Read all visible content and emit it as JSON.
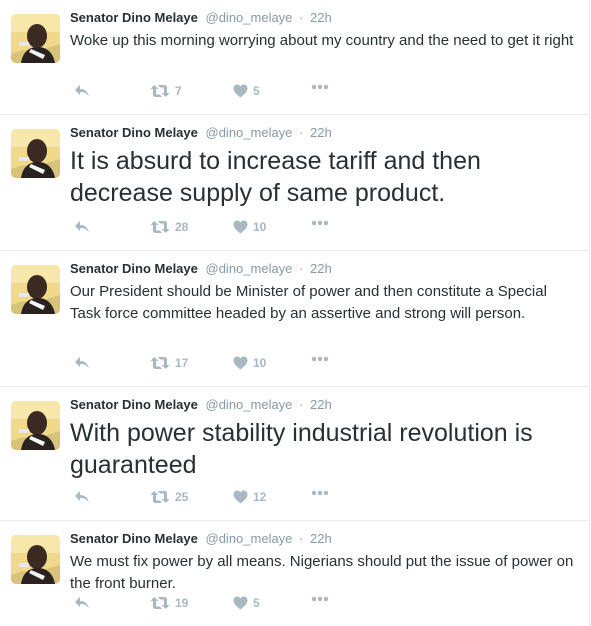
{
  "tweets": [
    {
      "name": "Senator Dino Melaye",
      "handle": "@dino_melaye",
      "separator": "·",
      "time": "22h",
      "text": "Woke up this morning worrying about my country and the need to get it right",
      "text_size": "small",
      "retweets": "7",
      "likes": "5"
    },
    {
      "name": "Senator Dino Melaye",
      "handle": "@dino_melaye",
      "separator": "·",
      "time": "22h",
      "text": "It is absurd to increase tariff and then decrease supply of same product.",
      "text_size": "large",
      "retweets": "28",
      "likes": "10"
    },
    {
      "name": "Senator Dino Melaye",
      "handle": "@dino_melaye",
      "separator": "·",
      "time": "22h",
      "text": "Our President should be Minister of power and then constitute a Special Task force committee headed by an assertive and strong will person.",
      "text_size": "small",
      "retweets": "17",
      "likes": "10"
    },
    {
      "name": "Senator Dino Melaye",
      "handle": "@dino_melaye",
      "separator": "·",
      "time": "22h",
      "text": "With power stability industrial revolution is guaranteed",
      "text_size": "large",
      "retweets": "25",
      "likes": "12"
    },
    {
      "name": "Senator Dino Melaye",
      "handle": "@dino_melaye",
      "separator": "·",
      "time": "22h",
      "text": "We must fix power by all means. Nigerians should put the issue of power on the front burner.",
      "text_size": "small",
      "retweets": "19",
      "likes": "5"
    }
  ],
  "icons": {
    "reply": "reply-icon",
    "retweet": "retweet-icon",
    "like": "heart-icon",
    "more": "more-dots-icon",
    "avatar": "avatar"
  },
  "colors": {
    "text": "#292f33",
    "muted": "#8899a6",
    "action": "#aab8c2",
    "divider": "#e6ecf0"
  }
}
